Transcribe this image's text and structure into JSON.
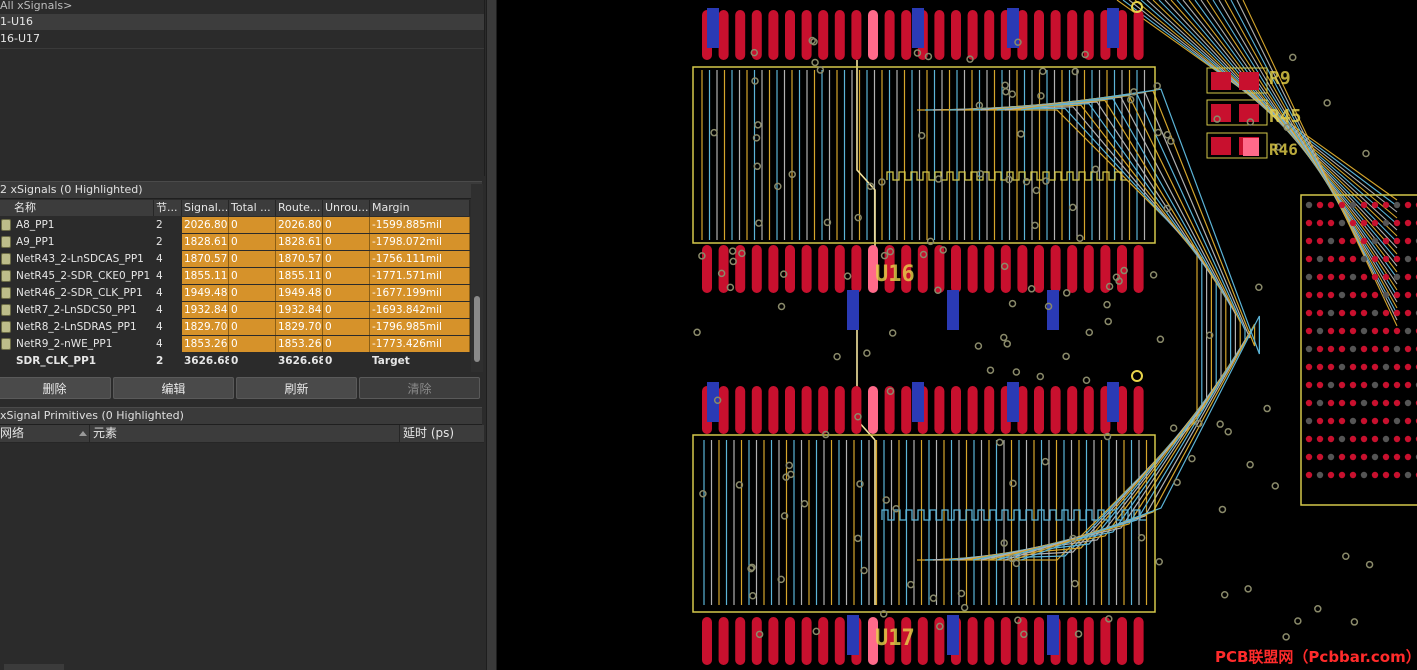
{
  "top_list": {
    "items": [
      "All xSignals>",
      "1-U16",
      "16-U17"
    ]
  },
  "xsignals_panel": {
    "header": "2 xSignals (0 Highlighted)",
    "columns": [
      "名称",
      "节...",
      "Signal...",
      "Total ...",
      "Route...",
      "Unrou...",
      "Margin"
    ],
    "rows": [
      {
        "name": "A8_PP1",
        "nodes": "2",
        "signal": "2026.802",
        "total": "0",
        "route": "2026.802",
        "unrouted": "0",
        "margin": "-1599.885mil"
      },
      {
        "name": "A9_PP1",
        "nodes": "2",
        "signal": "1828.615",
        "total": "0",
        "route": "1828.615",
        "unrouted": "0",
        "margin": "-1798.072mil"
      },
      {
        "name": "NetR43_2-LnSDCAS_PP1",
        "nodes": "4",
        "signal": "1870.576",
        "total": "0",
        "route": "1870.576",
        "unrouted": "0",
        "margin": "-1756.111mil"
      },
      {
        "name": "NetR45_2-SDR_CKE0_PP1",
        "nodes": "4",
        "signal": "1855.117",
        "total": "0",
        "route": "1855.117",
        "unrouted": "0",
        "margin": "-1771.571mil"
      },
      {
        "name": "NetR46_2-SDR_CLK_PP1",
        "nodes": "4",
        "signal": "1949.488",
        "total": "0",
        "route": "1949.488",
        "unrouted": "0",
        "margin": "-1677.199mil"
      },
      {
        "name": "NetR7_2-LnSDCS0_PP1",
        "nodes": "4",
        "signal": "1932.845",
        "total": "0",
        "route": "1932.845",
        "unrouted": "0",
        "margin": "-1693.842mil"
      },
      {
        "name": "NetR8_2-LnSDRAS_PP1",
        "nodes": "4",
        "signal": "1829.703",
        "total": "0",
        "route": "1829.703",
        "unrouted": "0",
        "margin": "-1796.985mil"
      },
      {
        "name": "NetR9_2-nWE_PP1",
        "nodes": "4",
        "signal": "1853.261",
        "total": "0",
        "route": "1853.261",
        "unrouted": "0",
        "margin": "-1773.426mil"
      }
    ],
    "target_row": {
      "name": "SDR_CLK_PP1",
      "nodes": "2",
      "signal": "3626.687",
      "total": "0",
      "route": "3626.687",
      "unrouted": "0",
      "margin": "Target"
    },
    "buttons": {
      "delete": "删除",
      "edit": "编辑",
      "refresh": "刷新",
      "clear": "清除"
    }
  },
  "primitives_panel": {
    "header": "xSignal Primitives (0 Highlighted)",
    "columns": [
      "网络",
      "元素",
      "延时 (ps)"
    ]
  },
  "pcb": {
    "designators": [
      "U16",
      "U17",
      "R9",
      "R45",
      "R46"
    ],
    "colors": {
      "pad": "#c8102e",
      "outline": "#d4c84a",
      "trace_top": "#d4a52c",
      "trace_inner": "#5bb3d6",
      "trace_bottom": "#b0b0b0",
      "via": "#8a8a6a",
      "highlight": "#ff6a8a"
    }
  },
  "watermark": "PCB联盟网（Pcbbar.com）"
}
